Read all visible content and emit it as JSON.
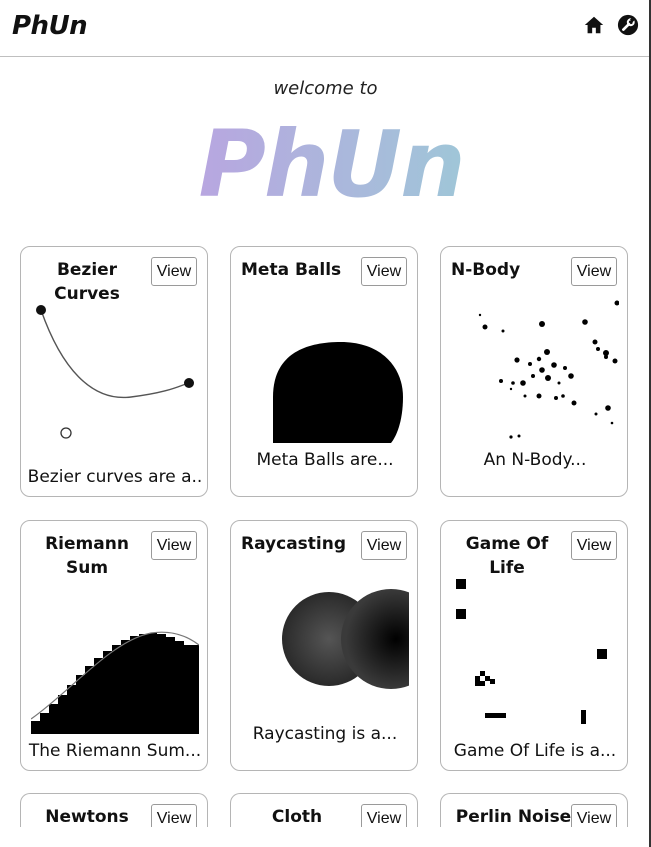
{
  "header": {
    "brand": "PhUn",
    "home_icon": "home-icon",
    "tools_icon": "wrench-icon"
  },
  "hero": {
    "welcome": "welcome to",
    "title": "PhUn",
    "gradient": [
      "#b8a6e0",
      "#9fc6d8"
    ]
  },
  "cards": [
    {
      "title": "Bezier Curves",
      "view": "View",
      "description": "Bezier curves are a.."
    },
    {
      "title": "Meta Balls",
      "view": "View",
      "description": "Meta Balls are..."
    },
    {
      "title": "N-Body",
      "view": "View",
      "description": "An N-Body..."
    },
    {
      "title": "Riemann Sum",
      "view": "View",
      "description": "The Riemann Sum..."
    },
    {
      "title": "Raycasting",
      "view": "View",
      "description": "Raycasting is a..."
    },
    {
      "title": "Game Of Life",
      "view": "View",
      "description": "Game Of Life is a..."
    },
    {
      "title": "Newtons",
      "view": "View",
      "description": ""
    },
    {
      "title": "Cloth",
      "view": "View",
      "description": ""
    },
    {
      "title": "Perlin Noise",
      "view": "View",
      "description": ""
    }
  ]
}
